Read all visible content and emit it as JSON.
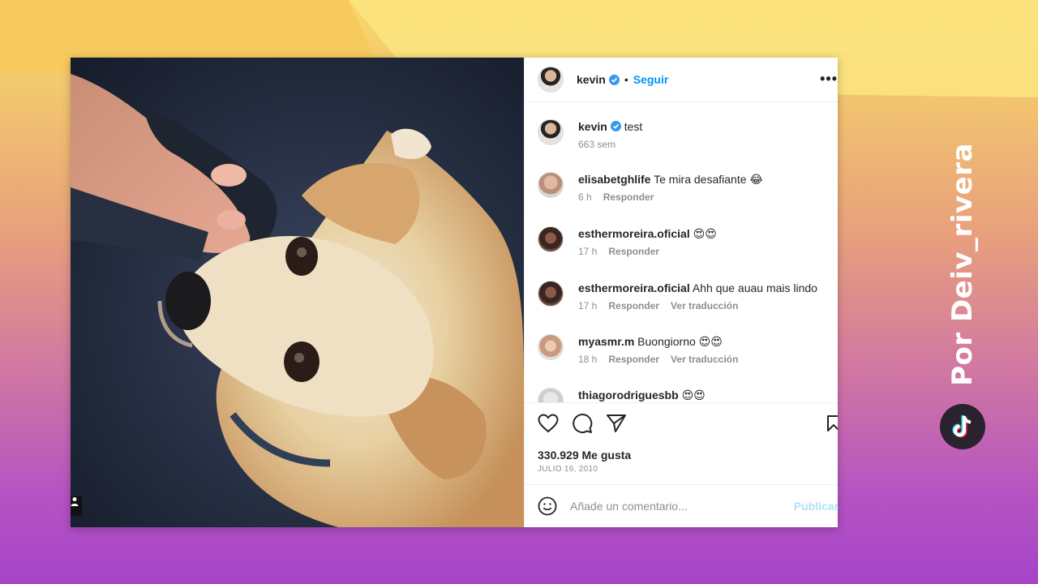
{
  "post": {
    "username": "kevin",
    "follow_label": "Seguir",
    "more_label": "•••",
    "dot": "•",
    "caption_user": "kevin",
    "caption_text": "test",
    "caption_time": "663 sem",
    "likes": "330.929 Me gusta",
    "date": "JULIO 16, 2010",
    "add_comment_placeholder": "Añade un comentario...",
    "publish_label": "Publicar"
  },
  "comments": [
    {
      "user": "elisabetghlife",
      "text": "Te mira desafiante 😂",
      "time": "6 h",
      "reply": "Responder",
      "translate": ""
    },
    {
      "user": "esthermoreira.oficial",
      "text": "😍😍",
      "time": "17 h",
      "reply": "Responder",
      "translate": ""
    },
    {
      "user": "esthermoreira.oficial",
      "text": "Ahh que auau mais lindo",
      "time": "17 h",
      "reply": "Responder",
      "translate": "Ver traducción"
    },
    {
      "user": "myasmr.m",
      "text": "Buongiorno 😍😍",
      "time": "18 h",
      "reply": "Responder",
      "translate": "Ver traducción"
    },
    {
      "user": "thiagorodriguesbb",
      "text": "😍😍",
      "time": "",
      "reply": "",
      "translate": ""
    }
  ],
  "watermark": {
    "text": "Por Deiv_rivera",
    "icon": "tiktok-icon"
  },
  "colors": {
    "accent": "#0095f6",
    "publish_disabled": "#b2dffc",
    "verified": "#3897f0"
  }
}
